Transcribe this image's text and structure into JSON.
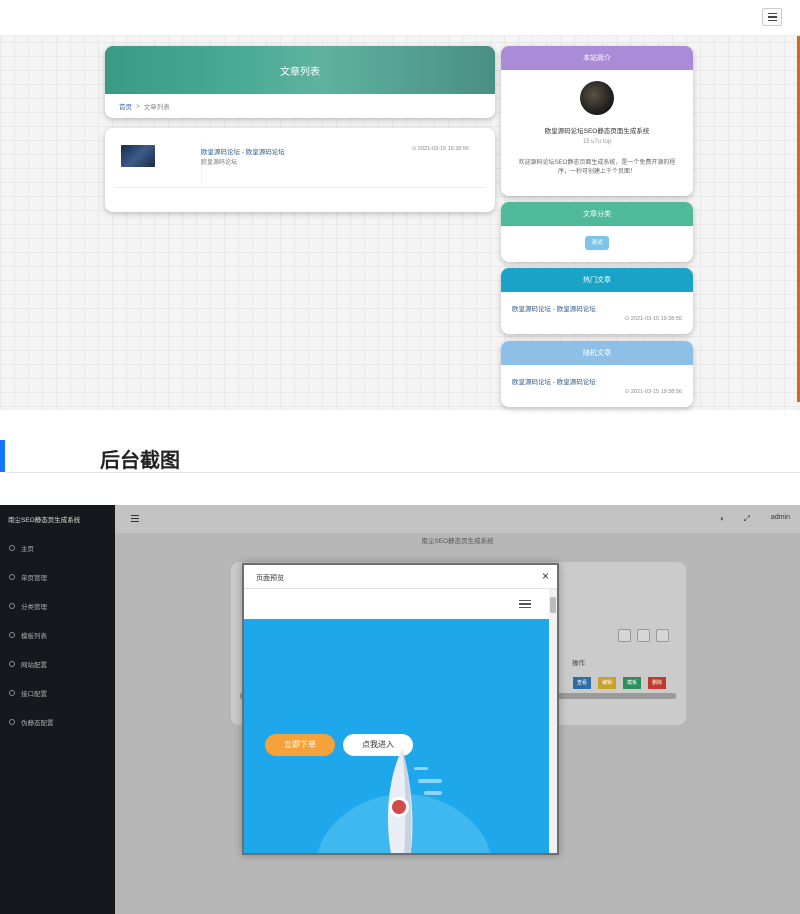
{
  "front": {
    "list_title": "文章列表",
    "breadcrumb": {
      "home": "首页",
      "separator": ">",
      "current": "文章列表"
    },
    "article": {
      "title": "欧皇源码论坛 - 欧皇源码论坛",
      "subtitle": "欧皇源码论坛",
      "time": "2021-03-15 19:38:56"
    },
    "intro": {
      "header": "本站简介",
      "name": "欧皇源码论坛SEO静态页面生成系统",
      "version": "15 u7u top",
      "description": "欢迎源码论坛SEO静态页面生成系统，是一个免费开源的程序，一秒可创建上千个页面！"
    },
    "category": {
      "header": "文章分类",
      "tag": "测试"
    },
    "hot": {
      "header": "热门文章",
      "link": "欧皇源码论坛 - 欧皇源码论坛",
      "time": "2021-03-15 19:38:56"
    },
    "random": {
      "header": "随机文章",
      "link": "欧皇源码论坛 - 欧皇源码论坛",
      "time": "2021-03-15 19:38:56"
    }
  },
  "section_heading": "后台截图",
  "admin": {
    "logo": "南尘SEO静态页生成系统",
    "nav": [
      "主页",
      "单页管理",
      "分类管理",
      "模板列表",
      "网站配置",
      "接口配置",
      "伪静态配置"
    ],
    "user": "admin",
    "subtitle": "南尘SEO静态页生成系统",
    "ops_header": "操作",
    "ops": [
      {
        "label": "查看",
        "color": "#2d6ea8"
      },
      {
        "label": "编辑",
        "color": "#c9a227"
      },
      {
        "label": "模板",
        "color": "#2f8f5a"
      },
      {
        "label": "删除",
        "color": "#c0392b"
      }
    ],
    "modal": {
      "title": "页面预览",
      "close": "×",
      "order_button": "立即下单",
      "enter_button": "点我进入"
    }
  },
  "colors": {
    "intro_header": "#a98bd8",
    "category_header": "#4fb99a",
    "hot_header": "#1aa3c6",
    "random_header": "#8ebfe6",
    "accent": "#1677ff",
    "preview_bg": "#1fa7ec"
  }
}
